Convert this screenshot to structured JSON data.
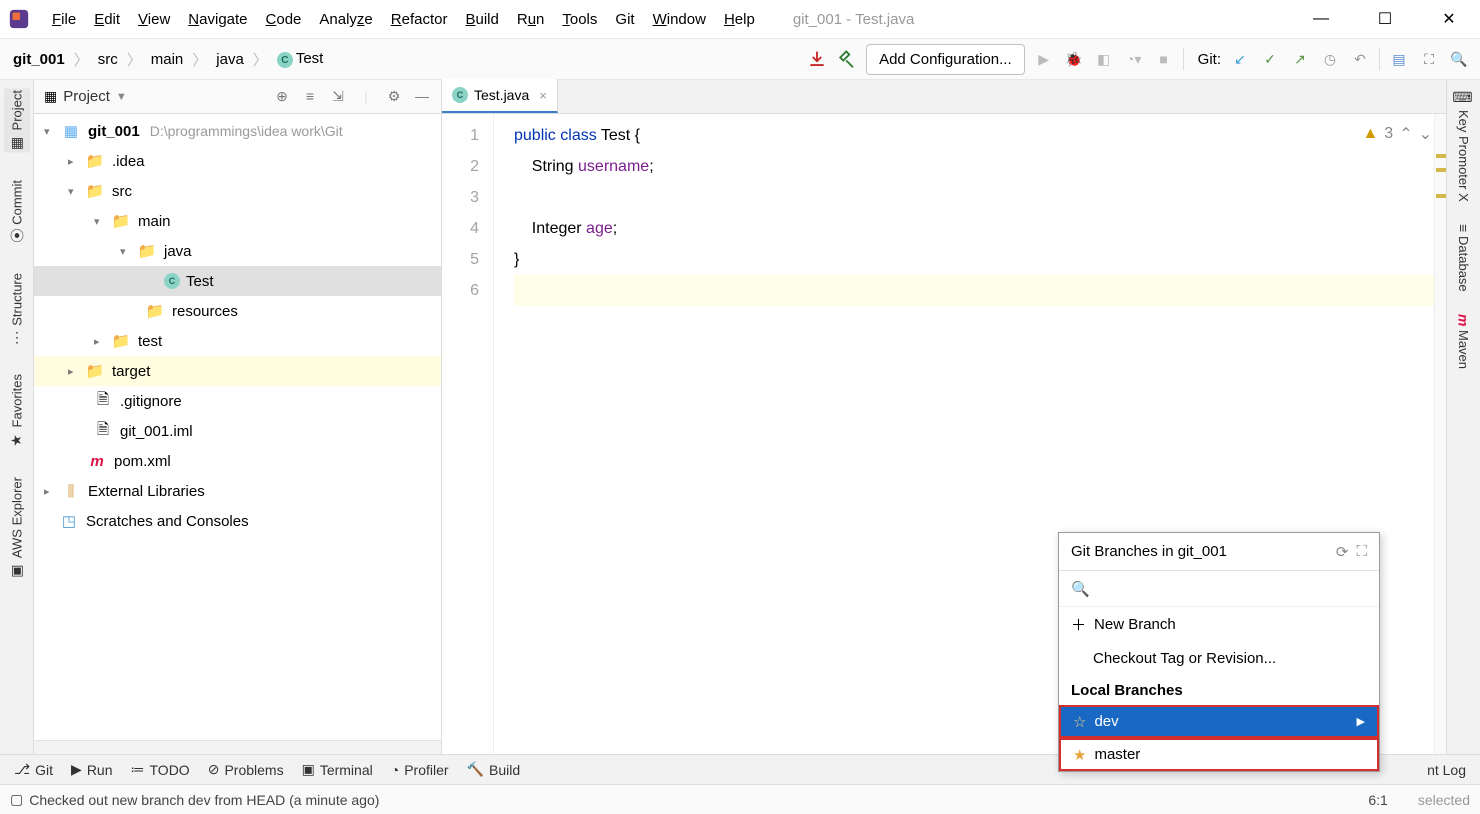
{
  "window": {
    "title": "git_001 - Test.java"
  },
  "menu": {
    "file": "File",
    "edit": "Edit",
    "view": "View",
    "navigate": "Navigate",
    "code": "Code",
    "analyze": "Analyze",
    "refactor": "Refactor",
    "build": "Build",
    "run": "Run",
    "tools": "Tools",
    "git": "Git",
    "window": "Window",
    "help": "Help"
  },
  "breadcrumb": {
    "root": "git_001",
    "items": [
      "src",
      "main",
      "java"
    ],
    "last": "Test"
  },
  "toolbar": {
    "add_config": "Add Configuration...",
    "git_label": "Git:"
  },
  "leftrail": [
    "Project",
    "Commit",
    "Structure",
    "Favorites",
    "AWS Explorer"
  ],
  "rightrail": [
    "Key Promoter X",
    "Database",
    "Maven"
  ],
  "project": {
    "header": "Project",
    "root": {
      "name": "git_001",
      "path": "D:\\programmings\\idea work\\Git"
    },
    "items": {
      "idea": ".idea",
      "src": "src",
      "main": "main",
      "java": "java",
      "test_class": "Test",
      "resources": "resources",
      "test": "test",
      "target": "target",
      "gitignore": ".gitignore",
      "iml": "git_001.iml",
      "pom": "pom.xml",
      "ext": "External Libraries",
      "scratch": "Scratches and Consoles"
    }
  },
  "editor": {
    "tab": "Test.java",
    "gutter": [
      "1",
      "2",
      "3",
      "4",
      "5",
      "6"
    ],
    "code": {
      "l1": {
        "indent": "",
        "kw1": "public",
        "kw2": "class",
        "name": "Test",
        "brace": " {"
      },
      "l2": {
        "indent": "    ",
        "type": "String",
        "field": "username",
        "semi": ";"
      },
      "l3": "",
      "l4": {
        "indent": "    ",
        "type": "Integer",
        "field": "age",
        "semi": ";"
      },
      "l5": {
        "brace": "}"
      },
      "l6": ""
    },
    "badge_count": "3"
  },
  "bottombar": {
    "git": "Git",
    "run": "Run",
    "todo": "TODO",
    "problems": "Problems",
    "terminal": "Terminal",
    "profiler": "Profiler",
    "build": "Build",
    "eventlog": "nt Log"
  },
  "status": {
    "message": "Checked out new branch dev from HEAD (a minute ago)",
    "pos": "6:1",
    "selected": "selected"
  },
  "popup": {
    "title": "Git Branches in git_001",
    "new_branch": "New Branch",
    "checkout": "Checkout Tag or Revision...",
    "local_section": "Local Branches",
    "branches": {
      "dev": "dev",
      "master": "master"
    }
  }
}
